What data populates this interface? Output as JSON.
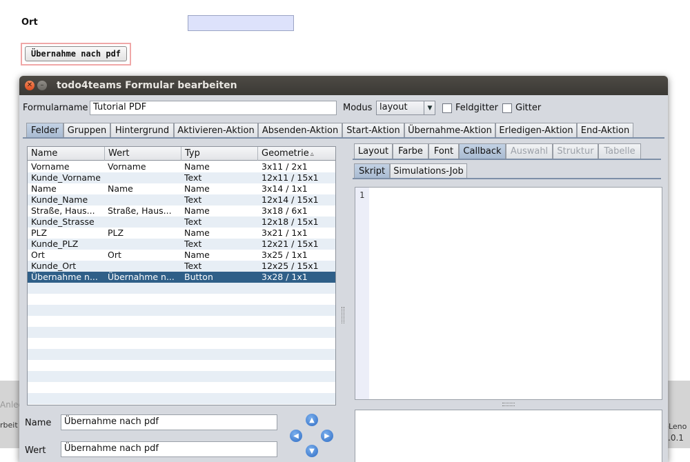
{
  "background": {
    "ort_label": "Ort",
    "uebernahme_button": "Übernahme nach pdf",
    "strip_left_top": "Anleg",
    "strip_left_bottom": "rbeit",
    "strip_right_top": "-Leno",
    "strip_right_bottom": ".0.1"
  },
  "dialog": {
    "title": "todo4teams Formular bearbeiten",
    "close_glyph": "✕",
    "min_glyph": "–",
    "formularname_label": "Formularname",
    "formularname_value": "Tutorial PDF",
    "modus_label": "Modus",
    "modus_value": "layout",
    "feldgitter_label": "Feldgitter",
    "gitter_label": "Gitter",
    "tabs": [
      "Felder",
      "Gruppen",
      "Hintergrund",
      "Aktivieren-Aktion",
      "Absenden-Aktion",
      "Start-Aktion",
      "Übernahme-Aktion",
      "Erledigen-Aktion",
      "End-Aktion"
    ],
    "selected_tab": "Felder"
  },
  "table": {
    "columns": [
      "Name",
      "Wert",
      "Typ",
      "Geometrie"
    ],
    "sort_indicator": "▵",
    "rows": [
      {
        "name": "Vorname",
        "wert": "Vorname",
        "typ": "Name",
        "geometrie": "3x11 / 2x1"
      },
      {
        "name": "Kunde_Vorname",
        "wert": "",
        "typ": "Text",
        "geometrie": "12x11 / 15x1"
      },
      {
        "name": "Name",
        "wert": "Name",
        "typ": "Name",
        "geometrie": "3x14 / 1x1"
      },
      {
        "name": "Kunde_Name",
        "wert": "",
        "typ": "Text",
        "geometrie": "12x14 / 15x1"
      },
      {
        "name": "Straße, Haus...",
        "wert": "Straße, Haus...",
        "typ": "Name",
        "geometrie": "3x18 / 6x1"
      },
      {
        "name": "Kunde_Strasse",
        "wert": "",
        "typ": "Text",
        "geometrie": "12x18 / 15x1"
      },
      {
        "name": "PLZ",
        "wert": "PLZ",
        "typ": "Name",
        "geometrie": "3x21 / 1x1"
      },
      {
        "name": "Kunde_PLZ",
        "wert": "",
        "typ": "Text",
        "geometrie": "12x21 / 15x1"
      },
      {
        "name": "Ort",
        "wert": "Ort",
        "typ": "Name",
        "geometrie": "3x25 / 1x1"
      },
      {
        "name": "Kunde_Ort",
        "wert": "",
        "typ": "Text",
        "geometrie": "12x25 / 15x1"
      },
      {
        "name": "Übernahme n...",
        "wert": "Übernahme n...",
        "typ": "Button",
        "geometrie": "3x28 / 1x1"
      }
    ],
    "selected_row": "Übernahme n..."
  },
  "details": {
    "name_label": "Name",
    "name_value": "Übernahme nach pdf",
    "wert_label": "Wert",
    "wert_value": "Übernahme nach pdf"
  },
  "nav_icons": {
    "up": "▲",
    "left": "◀",
    "right": "▶",
    "down": "▼"
  },
  "right_panel": {
    "tabs": [
      "Layout",
      "Farbe",
      "Font",
      "Callback",
      "Auswahl",
      "Struktur",
      "Tabelle"
    ],
    "selected_tab": "Callback",
    "disabled_tabs": [
      "Auswahl",
      "Struktur",
      "Tabelle"
    ],
    "subtabs": [
      "Skript",
      "Simulations-Job"
    ],
    "selected_subtab": "Skript",
    "editor_line_number": "1",
    "editor_content": ""
  },
  "colors": {
    "selection": "#2f5f88",
    "tab_selected": "#b6c6da",
    "titlebar": "#3f3d39",
    "close_button": "#e8622f"
  }
}
